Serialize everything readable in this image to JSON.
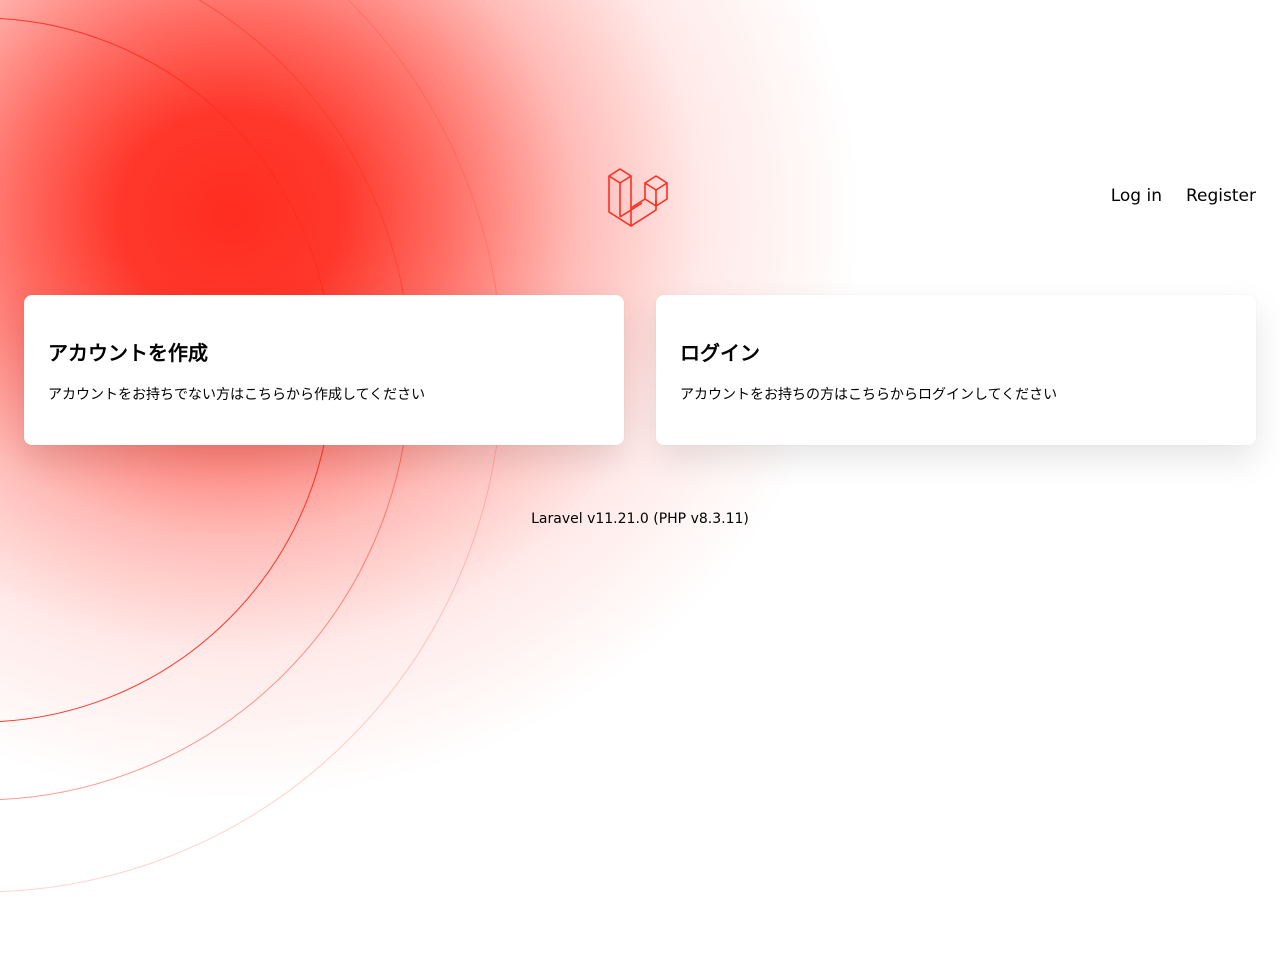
{
  "nav": {
    "login_label": "Log in",
    "register_label": "Register"
  },
  "logo": {
    "icon": "laravel-logo-icon",
    "color": "#FF2D20"
  },
  "cards": {
    "register": {
      "title": "アカウントを作成",
      "description": "アカウントをお持ちでない方はこちらから作成してください"
    },
    "login": {
      "title": "ログイン",
      "description": "アカウントをお持ちの方はこちらからログインしてください"
    }
  },
  "footer": {
    "version": "Laravel v11.21.0 (PHP v8.3.11)"
  },
  "colors": {
    "accent": "#FF2D20",
    "background": "#FFFFFF",
    "text": "#000000"
  }
}
